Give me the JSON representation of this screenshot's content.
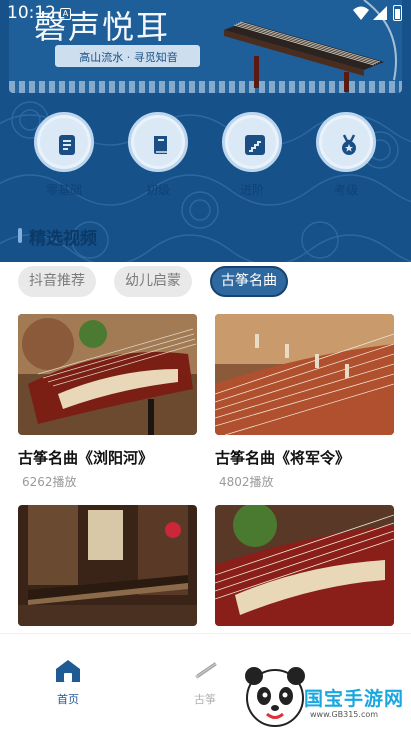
{
  "status_bar": {
    "time": "10:12"
  },
  "banner": {
    "title": "磬声悦耳",
    "subtitle": "高山流水 · 寻觅知音"
  },
  "categories": [
    {
      "label": "零基础",
      "icon": "document-icon"
    },
    {
      "label": "初级",
      "icon": "book-icon"
    },
    {
      "label": "进阶",
      "icon": "stairs-icon"
    },
    {
      "label": "考级",
      "icon": "medal-icon"
    }
  ],
  "section": {
    "title": "精选视频"
  },
  "tabs": [
    {
      "label": "抖音推荐",
      "active": false
    },
    {
      "label": "幼儿启蒙",
      "active": false
    },
    {
      "label": "古筝名曲",
      "active": true
    }
  ],
  "videos": [
    {
      "title": "古筝名曲《浏阳河》",
      "plays": "6262播放"
    },
    {
      "title": "古筝名曲《将军令》",
      "plays": "4802播放"
    },
    {
      "title": "",
      "plays": ""
    },
    {
      "title": "",
      "plays": ""
    }
  ],
  "bottom_nav": [
    {
      "label": "首页",
      "icon": "home-icon",
      "active": true
    },
    {
      "label": "古筝",
      "icon": "guzheng-icon",
      "active": false
    }
  ],
  "watermark": {
    "brand": "国宝手游网",
    "url": "www.GB315.com"
  },
  "colors": {
    "primary_blue": "#16518a",
    "active_tab": "#2e689e",
    "tab_inactive_bg": "#e9e9e9",
    "circle_bg": "#dbe9f6"
  }
}
